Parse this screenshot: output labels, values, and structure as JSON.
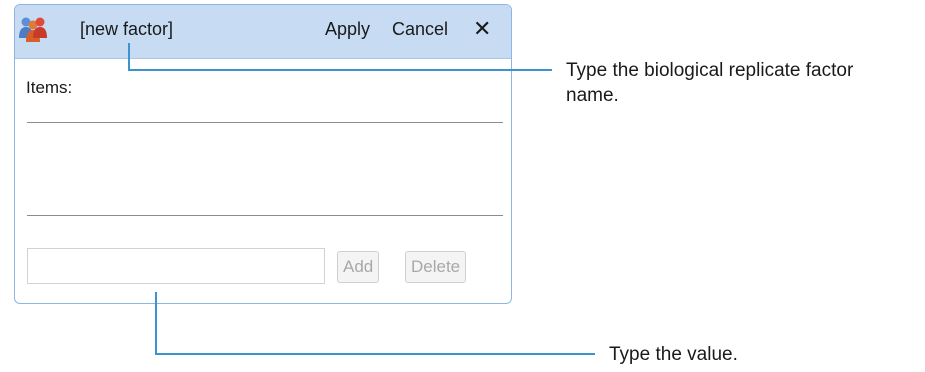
{
  "dialog": {
    "header": {
      "icon": "users-group-icon",
      "factor_name": "[new factor]",
      "apply_label": "Apply",
      "cancel_label": "Cancel",
      "close_glyph": "✕"
    },
    "items_label": "Items:",
    "value_input": {
      "value": "",
      "placeholder": ""
    },
    "add_label": "Add",
    "delete_label": "Delete"
  },
  "callouts": {
    "factor_name": {
      "line1": "Type the biological replicate factor",
      "line2": "name."
    },
    "value": "Type the value."
  },
  "colors": {
    "header_bg": "#c7dcf3",
    "border": "#8fb6e0",
    "callout_line": "#3d93d0",
    "disabled_text": "#a8a8a8"
  }
}
